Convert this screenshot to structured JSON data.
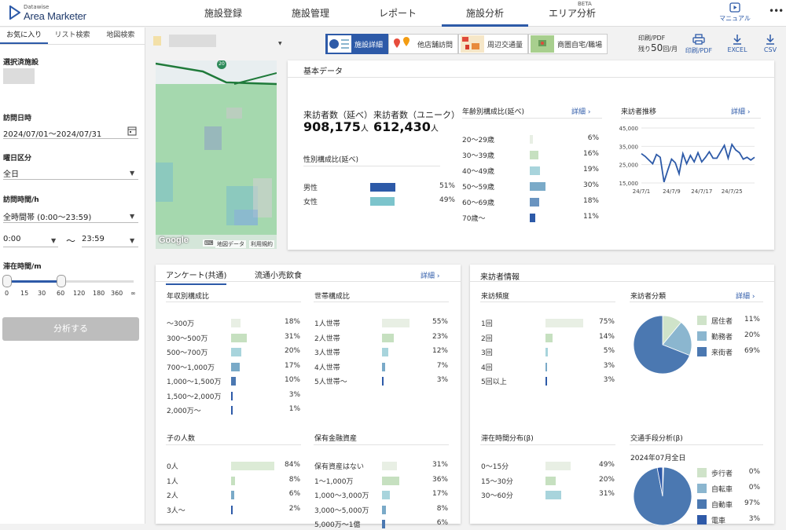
{
  "header": {
    "logo_small": "Datawise",
    "logo_big": "Area Marketer",
    "nav": [
      {
        "label": "施設登録"
      },
      {
        "label": "施設管理"
      },
      {
        "label": "レポート"
      },
      {
        "label": "施設分析"
      },
      {
        "label": "エリア分析",
        "badge": "BETA"
      }
    ],
    "manual": "マニュアル",
    "more": "•••"
  },
  "sidebar": {
    "tabs": [
      "お気に入り",
      "リスト検索",
      "地図検索"
    ],
    "selected_label": "選択済施設",
    "visit_date_label": "訪問日時",
    "visit_date": "2024/07/01〜2024/07/31",
    "weekday_label": "曜日区分",
    "weekday": "全日",
    "visit_time_label": "訪問時間/h",
    "visit_time": "全時間帯 (0:00〜23:59)",
    "time_from": "0:00",
    "time_sep": "〜",
    "time_to": "23:59",
    "stay_label": "滞在時間/m",
    "ticks": [
      "0",
      "15",
      "30",
      "60",
      "120",
      "180",
      "360",
      "∞"
    ],
    "slider_value": "0〜60",
    "analyze": "分析する"
  },
  "views": [
    {
      "label": "施設詳細"
    },
    {
      "label": "他店舗訪問"
    },
    {
      "label": "周辺交通量"
    },
    {
      "label": "商圏自宅/職場"
    }
  ],
  "pdf": {
    "line1": "印刷/PDF",
    "remain_prefix": "残り",
    "remain_num": "50",
    "remain_suffix": "回/月"
  },
  "toolbar": {
    "print": "印刷/PDF",
    "excel": "EXCEL",
    "csv": "CSV"
  },
  "map": {
    "google": "Google",
    "keyboard": "⌨",
    "mapdata": "地図データ",
    "terms": "利用規約",
    "pin": "20"
  },
  "basic": {
    "title": "基本データ",
    "visitors_total_label": "来訪者数（延べ）",
    "visitors_total": "908,175",
    "visitors_unique_label": "来訪者数（ユニーク）",
    "visitors_unique": "612,430",
    "unit": "人",
    "gender_title": "性別構成比(延べ)",
    "gender": [
      {
        "label": "男性",
        "pct": "51%",
        "v": 51
      },
      {
        "label": "女性",
        "pct": "49%",
        "v": 49
      }
    ],
    "age_title": "年齢別構成比(延べ)",
    "detail": "詳細 ›",
    "age": [
      {
        "label": "20〜29歳",
        "pct": "6%",
        "v": 6
      },
      {
        "label": "30〜39歳",
        "pct": "16%",
        "v": 16
      },
      {
        "label": "40〜49歳",
        "pct": "19%",
        "v": 19
      },
      {
        "label": "50〜59歳",
        "pct": "30%",
        "v": 30
      },
      {
        "label": "60〜69歳",
        "pct": "18%",
        "v": 18
      },
      {
        "label": "70歳〜",
        "pct": "11%",
        "v": 11
      }
    ],
    "trend_title": "来訪者推移"
  },
  "chart_data": {
    "type": "line",
    "x": [
      "24/7/1",
      "24/7/2",
      "24/7/3",
      "24/7/4",
      "24/7/5",
      "24/7/6",
      "24/7/7",
      "24/7/8",
      "24/7/9",
      "24/7/10",
      "24/7/11",
      "24/7/12",
      "24/7/13",
      "24/7/14",
      "24/7/15",
      "24/7/16",
      "24/7/17",
      "24/7/18",
      "24/7/19",
      "24/7/20",
      "24/7/21",
      "24/7/22",
      "24/7/23",
      "24/7/24",
      "24/7/25",
      "24/7/26",
      "24/7/27",
      "24/7/28",
      "24/7/29",
      "24/7/30",
      "24/7/31"
    ],
    "values": [
      31000,
      29500,
      27500,
      25500,
      30500,
      29000,
      15500,
      22000,
      28000,
      26000,
      20000,
      31000,
      25500,
      30000,
      26500,
      31500,
      26500,
      29000,
      32000,
      28500,
      28500,
      32000,
      35500,
      28500,
      36000,
      33000,
      31500,
      28000,
      29000,
      27500,
      29000
    ],
    "xticks": [
      "24/7/1",
      "24/7/9",
      "24/7/17",
      "24/7/25"
    ],
    "yticks": [
      "45,000",
      "35,000",
      "25,000",
      "15,000"
    ],
    "ylim": [
      15000,
      45000
    ],
    "color": "#2d5aa8"
  },
  "survey": {
    "tabs": [
      "アンケート(共通)",
      "流通小売飲食"
    ],
    "detail": "詳細 ›",
    "income_title": "年収別構成比",
    "income": [
      {
        "label": "〜300万",
        "pct": "18%",
        "v": 18
      },
      {
        "label": "300〜500万",
        "pct": "31%",
        "v": 31
      },
      {
        "label": "500〜700万",
        "pct": "20%",
        "v": 20
      },
      {
        "label": "700〜1,000万",
        "pct": "17%",
        "v": 17
      },
      {
        "label": "1,000〜1,500万",
        "pct": "10%",
        "v": 10
      },
      {
        "label": "1,500〜2,000万",
        "pct": "3%",
        "v": 3
      },
      {
        "label": "2,000万〜",
        "pct": "1%",
        "v": 1
      }
    ],
    "household_title": "世帯構成比",
    "household": [
      {
        "label": "1人世帯",
        "pct": "55%",
        "v": 55
      },
      {
        "label": "2人世帯",
        "pct": "23%",
        "v": 23
      },
      {
        "label": "3人世帯",
        "pct": "12%",
        "v": 12
      },
      {
        "label": "4人世帯",
        "pct": "7%",
        "v": 7
      },
      {
        "label": "5人世帯〜",
        "pct": "3%",
        "v": 3
      }
    ],
    "children_title": "子の人数",
    "children": [
      {
        "label": "0人",
        "pct": "84%",
        "v": 84
      },
      {
        "label": "1人",
        "pct": "8%",
        "v": 8
      },
      {
        "label": "2人",
        "pct": "6%",
        "v": 6
      },
      {
        "label": "3人〜",
        "pct": "2%",
        "v": 2
      }
    ],
    "assets_title": "保有金融資産",
    "assets": [
      {
        "label": "保有資産はない",
        "pct": "31%",
        "v": 31
      },
      {
        "label": "1〜1,000万",
        "pct": "36%",
        "v": 36
      },
      {
        "label": "1,000〜3,000万",
        "pct": "17%",
        "v": 17
      },
      {
        "label": "3,000〜5,000万",
        "pct": "8%",
        "v": 8
      },
      {
        "label": "5,000万〜1億",
        "pct": "6%",
        "v": 6
      }
    ]
  },
  "visitor": {
    "title": "来訪者情報",
    "detail": "詳細 ›",
    "freq_title": "来訪頻度",
    "freq": [
      {
        "label": "1回",
        "pct": "75%",
        "v": 75
      },
      {
        "label": "2回",
        "pct": "14%",
        "v": 14
      },
      {
        "label": "3回",
        "pct": "5%",
        "v": 5
      },
      {
        "label": "4回",
        "pct": "3%",
        "v": 3
      },
      {
        "label": "5回以上",
        "pct": "3%",
        "v": 3
      }
    ],
    "type_title": "来訪者分類",
    "types": [
      {
        "label": "居住者",
        "pct": "11%",
        "v": 11,
        "color": "#cfe3c9"
      },
      {
        "label": "勤務者",
        "pct": "20%",
        "v": 20,
        "color": "#8bb6cf"
      },
      {
        "label": "来街者",
        "pct": "69%",
        "v": 69,
        "color": "#4b78b1"
      }
    ],
    "stay_title": "滞在時間分布(β)",
    "stay": [
      {
        "label": "0〜15分",
        "pct": "49%",
        "v": 49
      },
      {
        "label": "15〜30分",
        "pct": "20%",
        "v": 20
      },
      {
        "label": "30〜60分",
        "pct": "31%",
        "v": 31
      }
    ],
    "transport_title": "交通手段分析(β)",
    "transport_period": "2024年07月全日",
    "transport": [
      {
        "label": "歩行者",
        "pct": "0%",
        "v": 0.3,
        "color": "#cfe3c9"
      },
      {
        "label": "自転車",
        "pct": "0%",
        "v": 0.3,
        "color": "#8bb6cf"
      },
      {
        "label": "自動車",
        "pct": "97%",
        "v": 97,
        "color": "#4b78b1"
      },
      {
        "label": "電車",
        "pct": "3%",
        "v": 3,
        "color": "#2f5aa8"
      }
    ]
  }
}
